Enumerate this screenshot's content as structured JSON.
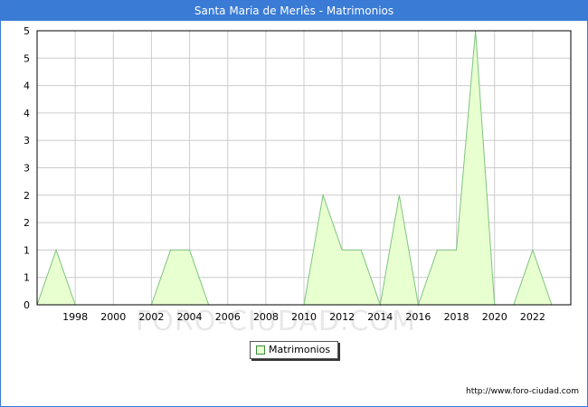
{
  "title": "Santa Maria de Merlès - Matrimonios",
  "watermark": "FORO-CIUDAD.COM",
  "source": "http://www.foro-ciudad.com",
  "legend": {
    "label": "Matrimonios"
  },
  "colors": {
    "header": "#3a7bd5",
    "fill": "#e8ffd0",
    "line": "#7fc37f",
    "grid": "#cccccc"
  },
  "chart_data": {
    "type": "area",
    "title": "Santa Maria de Merlès - Matrimonios",
    "xlabel": "",
    "ylabel": "",
    "xlim": [
      1996,
      2024
    ],
    "ylim": [
      0,
      5
    ],
    "x_ticks": [
      1998,
      2000,
      2002,
      2004,
      2006,
      2008,
      2010,
      2012,
      2014,
      2016,
      2018,
      2020,
      2022
    ],
    "y_tick_labels": [
      "0",
      "1",
      "1",
      "2",
      "2",
      "3",
      "3",
      "4",
      "4",
      "5",
      "5"
    ],
    "grid": true,
    "legend_position": "bottom-center",
    "series": [
      {
        "name": "Matrimonios",
        "x": [
          1996,
          1997,
          1998,
          1999,
          2000,
          2001,
          2002,
          2003,
          2004,
          2005,
          2006,
          2007,
          2008,
          2009,
          2010,
          2011,
          2012,
          2013,
          2014,
          2015,
          2016,
          2017,
          2018,
          2019,
          2020,
          2021,
          2022,
          2023
        ],
        "y": [
          0,
          1,
          0,
          0,
          0,
          0,
          0,
          1,
          1,
          0,
          0,
          0,
          0,
          0,
          0,
          2,
          1,
          1,
          0,
          2,
          0,
          1,
          1,
          5,
          0,
          0,
          1,
          0
        ]
      }
    ]
  }
}
